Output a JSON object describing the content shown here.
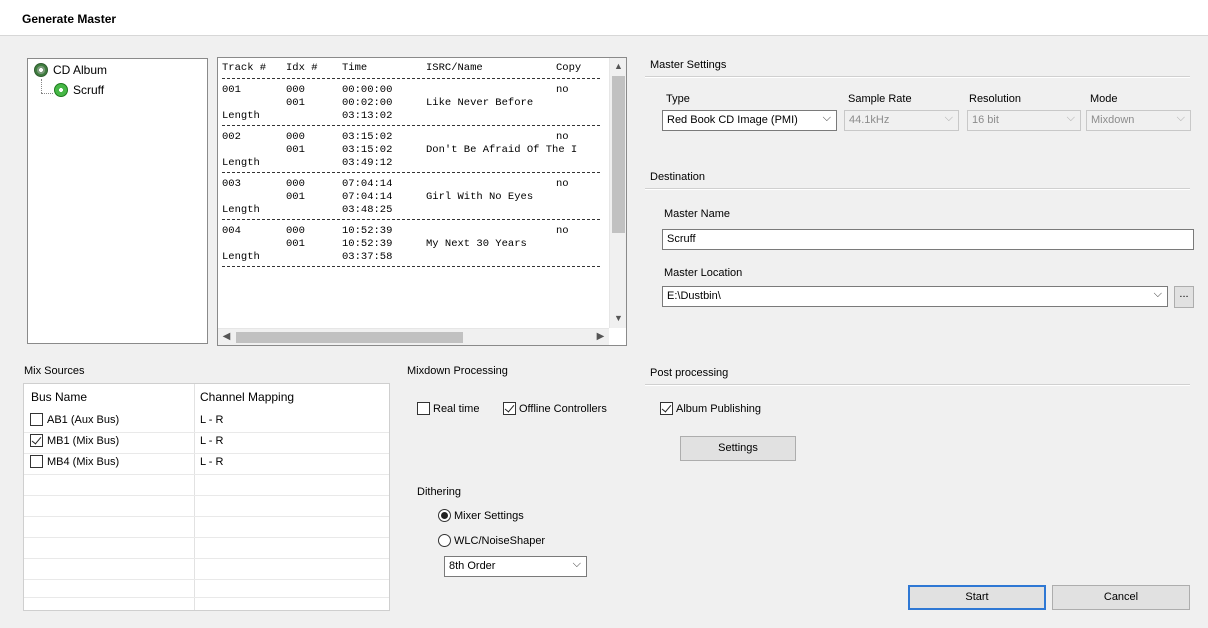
{
  "window": {
    "title": "Generate Master"
  },
  "tree": {
    "root": "CD Album",
    "child": "Scruff"
  },
  "tracklist": {
    "headers": [
      "Track #",
      "Idx #",
      "Time",
      "ISRC/Name",
      "Copy"
    ],
    "tracks": [
      {
        "track": "001",
        "rows": [
          [
            "000",
            "00:00:00",
            "",
            "no"
          ],
          [
            "001",
            "00:02:00",
            "Like Never Before",
            ""
          ]
        ],
        "length_label": "Length",
        "length": "03:13:02"
      },
      {
        "track": "002",
        "rows": [
          [
            "000",
            "03:15:02",
            "",
            "no"
          ],
          [
            "001",
            "03:15:02",
            "Don't Be Afraid Of The I",
            ""
          ]
        ],
        "length_label": "Length",
        "length": "03:49:12"
      },
      {
        "track": "003",
        "rows": [
          [
            "000",
            "07:04:14",
            "",
            "no"
          ],
          [
            "001",
            "07:04:14",
            "Girl With No Eyes",
            ""
          ]
        ],
        "length_label": "Length",
        "length": "03:48:25"
      },
      {
        "track": "004",
        "rows": [
          [
            "000",
            "10:52:39",
            "",
            "no"
          ],
          [
            "001",
            "10:52:39",
            "My Next 30 Years",
            ""
          ]
        ],
        "length_label": "Length",
        "length": "03:37:58"
      }
    ]
  },
  "master_settings": {
    "heading": "Master Settings",
    "type_label": "Type",
    "type_value": "Red Book CD Image (PMI)",
    "sample_rate_label": "Sample Rate",
    "sample_rate_value": "44.1kHz",
    "resolution_label": "Resolution",
    "resolution_value": "16 bit",
    "mode_label": "Mode",
    "mode_value": "Mixdown"
  },
  "destination": {
    "heading": "Destination",
    "name_label": "Master Name",
    "name_value": "Scruff",
    "location_label": "Master Location",
    "location_value": "E:\\Dustbin\\",
    "browse_label": "..."
  },
  "mix_sources": {
    "heading": "Mix Sources",
    "col_bus": "Bus Name",
    "col_channel": "Channel Mapping",
    "rows": [
      {
        "bus": "AB1 (Aux Bus)",
        "channel": "L - R",
        "checked": false
      },
      {
        "bus": "MB1 (Mix Bus)",
        "channel": "L - R",
        "checked": true
      },
      {
        "bus": "MB4 (Mix Bus)",
        "channel": "L - R",
        "checked": false
      }
    ]
  },
  "mixdown": {
    "heading": "Mixdown Processing",
    "realtime_label": "Real time",
    "realtime_checked": false,
    "offline_label": "Offline Controllers",
    "offline_checked": true,
    "dithering_label": "Dithering",
    "mixer_settings_label": "Mixer Settings",
    "mixer_settings_selected": true,
    "wlc_label": "WLC/NoiseShaper",
    "wlc_selected": false,
    "order_value": "8th Order"
  },
  "post_processing": {
    "heading": "Post processing",
    "album_publishing_label": "Album Publishing",
    "album_publishing_checked": true,
    "settings_label": "Settings"
  },
  "actions": {
    "start_label": "Start",
    "cancel_label": "Cancel"
  },
  "colors": {
    "default_button_border": "#2f78d4",
    "window_bg": "#f0f0f0"
  }
}
